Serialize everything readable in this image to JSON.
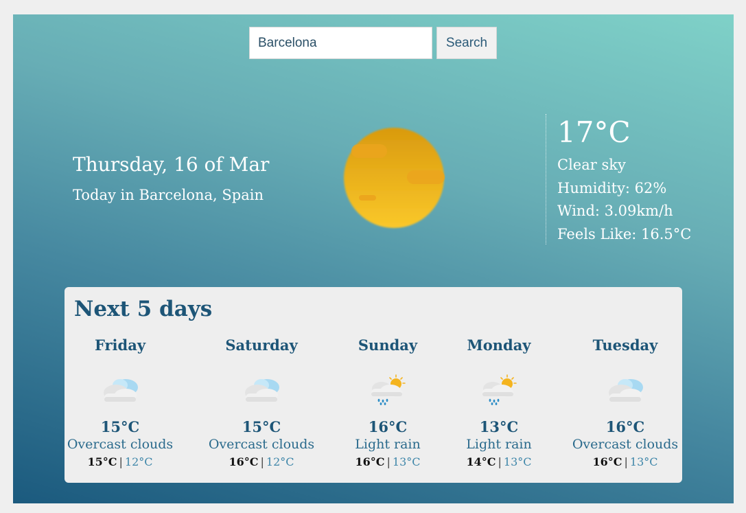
{
  "search": {
    "value": "Barcelona",
    "button_label": "Search"
  },
  "current": {
    "date": "Thursday, 16 of Mar",
    "location": "Today in Barcelona, Spain",
    "icon": "sun-icon",
    "temperature": "17°C",
    "description": "Clear sky",
    "humidity": "Humidity: 62%",
    "wind": "Wind: 3.09km/h",
    "feels_like": "Feels Like: 16.5°C"
  },
  "forecast": {
    "title": "Next 5 days",
    "days": [
      {
        "name": "Friday",
        "icon": "overcast-clouds-icon",
        "temp": "15°C",
        "desc": "Overcast clouds",
        "hi": "15°C",
        "lo": "12°C"
      },
      {
        "name": "Saturday",
        "icon": "overcast-clouds-icon",
        "temp": "15°C",
        "desc": "Overcast clouds",
        "hi": "16°C",
        "lo": "12°C"
      },
      {
        "name": "Sunday",
        "icon": "light-rain-icon",
        "temp": "16°C",
        "desc": "Light rain",
        "hi": "16°C",
        "lo": "13°C"
      },
      {
        "name": "Monday",
        "icon": "light-rain-icon",
        "temp": "13°C",
        "desc": "Light rain",
        "hi": "14°C",
        "lo": "13°C"
      },
      {
        "name": "Tuesday",
        "icon": "overcast-clouds-icon",
        "temp": "16°C",
        "desc": "Overcast clouds",
        "hi": "16°C",
        "lo": "13°C"
      }
    ]
  },
  "colors": {
    "accent": "#1d5577",
    "sun": "#f4b41f",
    "panel": "#eeeeee"
  }
}
